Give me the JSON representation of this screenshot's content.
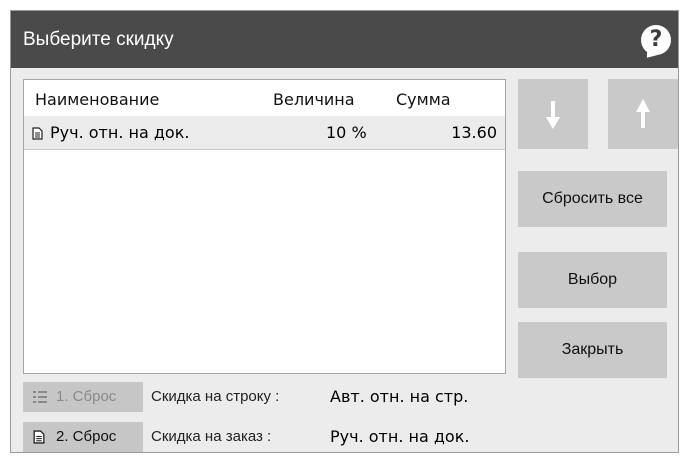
{
  "dialog": {
    "title": "Выберите скидку",
    "help_icon": "?"
  },
  "table": {
    "columns": [
      "Наименование",
      "Величина",
      "Сумма"
    ],
    "rows": [
      {
        "icon": "document-icon",
        "name": "Руч. отн. на док.",
        "value": "10 %",
        "sum": "13.60"
      }
    ]
  },
  "buttons": {
    "move_down_icon": "arrow-down-icon",
    "move_up_icon": "arrow-up-icon",
    "reset_all": "Сбросить все",
    "select": "Выбор",
    "close": "Закрыть"
  },
  "footer": {
    "line": {
      "chip": "1. Сброс",
      "label": "Скидка на строку :",
      "value": "Авт. отн. на стр."
    },
    "order": {
      "chip": "2. Сброс",
      "label": "Скидка на заказ :",
      "value": "Руч. отн. на док."
    }
  },
  "colors": {
    "titlebar": "#4a4a4a",
    "button": "#c9c9c9",
    "selected_row": "#ebebeb",
    "disabled_text": "#8a8a8a"
  }
}
